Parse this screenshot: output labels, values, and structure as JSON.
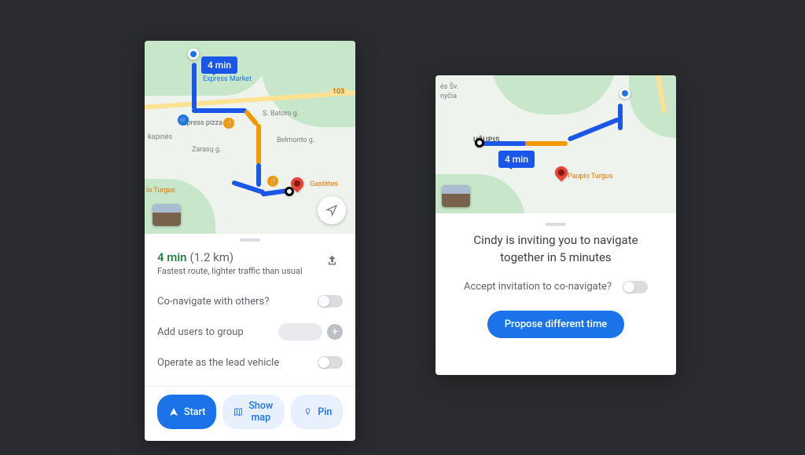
{
  "left": {
    "route_badge": "4 min",
    "map_labels": {
      "express_market": "Express Market",
      "express_pizza": "Express pizza",
      "kapines": "kapinės",
      "zarasu": "Zarasų g.",
      "belmonto": "Belmonto g.",
      "batoro": "S. Batoro g.",
      "turgus": "io Turgus",
      "gastetes": "Gastètes",
      "rd103": "103"
    },
    "summary": {
      "time": "4 min",
      "distance": "(1.2 km)",
      "sub": "Fastest route, lighter traffic than usual"
    },
    "options": {
      "co_nav": "Co-navigate  with others?",
      "add_users": "Add users to group",
      "lead": "Operate as the lead vehicle"
    },
    "actions": {
      "start": "Start",
      "show_map": "Show map",
      "pin": "Pin"
    }
  },
  "right": {
    "route_badge": "4 min",
    "map_labels": {
      "uzupis": "UŽUPIS",
      "paupio": "Paupio Turgus",
      "sv": "ės Šv.",
      "nycia": "nyčia"
    },
    "invite": "Cindy is inviting you to navigate together in 5 minutes",
    "accept_label": "Accept invitation to co-navigate?",
    "propose": "Propose different time"
  }
}
